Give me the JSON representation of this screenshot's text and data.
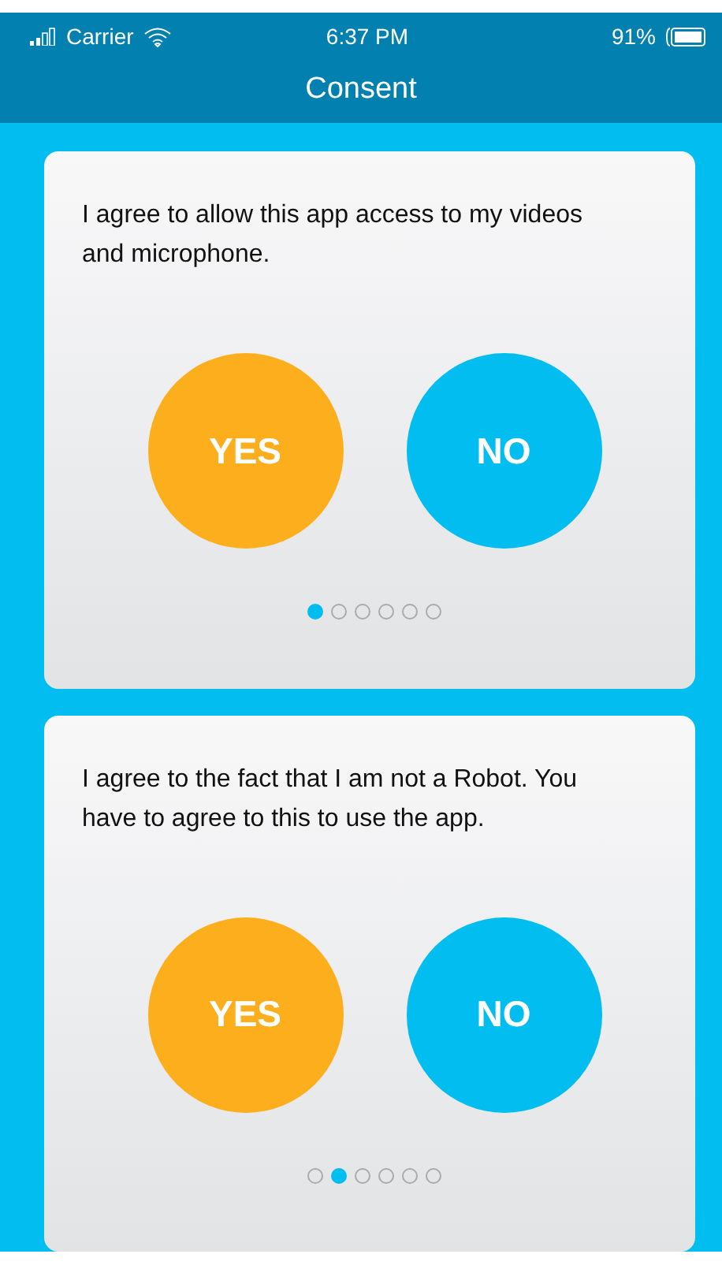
{
  "status_bar": {
    "carrier": "Carrier",
    "time": "6:37 PM",
    "battery": "91%"
  },
  "nav": {
    "title": "Consent"
  },
  "cards": [
    {
      "text": "I agree to allow this app access to my videos and microphone.",
      "buttons": [
        "YES",
        "NO"
      ],
      "pages": [
        {
          "selected": true
        },
        {
          "selected": false
        },
        {
          "selected": false
        },
        {
          "selected": false
        },
        {
          "selected": false
        },
        {
          "selected": false
        }
      ]
    },
    {
      "text": "I agree to the fact that I am not a Robot. You have to agree to this to use the app.",
      "buttons": [
        "YES",
        "NO"
      ],
      "pages": [
        {
          "selected": false
        },
        {
          "selected": true
        },
        {
          "selected": false
        },
        {
          "selected": false
        },
        {
          "selected": false
        },
        {
          "selected": false
        }
      ]
    }
  ]
}
